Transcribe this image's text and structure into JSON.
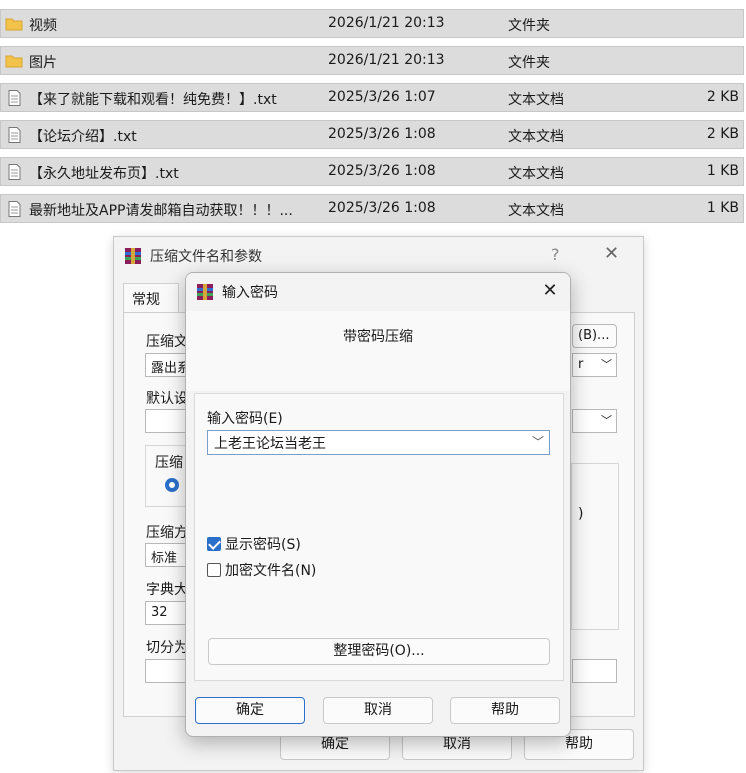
{
  "file_list": [
    {
      "name": "视频",
      "date": "2026/1/21 20:13",
      "type": "文件夹",
      "size": "",
      "icon": "folder-icon"
    },
    {
      "name": "图片",
      "date": "2026/1/21 20:13",
      "type": "文件夹",
      "size": "",
      "icon": "folder-icon"
    },
    {
      "name": "【来了就能下载和观看！纯免费！】.txt",
      "date": "2025/3/26 1:07",
      "type": "文本文档",
      "size": "2 KB",
      "icon": "text-file-icon"
    },
    {
      "name": "【论坛介绍】.txt",
      "date": "2025/3/26 1:08",
      "type": "文本文档",
      "size": "2 KB",
      "icon": "text-file-icon"
    },
    {
      "name": "【永久地址发布页】.txt",
      "date": "2025/3/26 1:08",
      "type": "文本文档",
      "size": "1 KB",
      "icon": "text-file-icon"
    },
    {
      "name": "最新地址及APP请发邮箱自动获取！！！...",
      "date": "2025/3/26 1:08",
      "type": "文本文档",
      "size": "1 KB",
      "icon": "text-file-icon"
    }
  ],
  "bg_dialog": {
    "title": "压缩文件名和参数",
    "help": "?",
    "close": "✕",
    "tab_general": "常规",
    "label_archive": "压缩文",
    "archive_value": "露出系",
    "browse_tail": "(B)...",
    "format_tail": "r",
    "label_default": "默认设",
    "label_format_group": "压缩",
    "label_method": "压缩方",
    "method_value": "标准",
    "label_dict": "字典大",
    "dict_value": "32",
    "label_split": "切分为",
    "paren_tail": ")",
    "ok": "确定",
    "cancel": "取消",
    "help_btn": "帮助"
  },
  "dialog": {
    "title": "输入密码",
    "close": "✕",
    "header": "带密码压缩",
    "password_label": "输入密码(E)",
    "password_value": "上老王论坛当老王",
    "show_password": "显示密码(S)",
    "show_password_checked": true,
    "encrypt_names": "加密文件名(N)",
    "encrypt_names_checked": false,
    "manage_button": "整理密码(O)...",
    "ok": "确定",
    "cancel": "取消",
    "help": "帮助"
  },
  "colors": {
    "accent": "#2a6fc9",
    "folder": "#f2c24b",
    "row_bg": "#dcdcdc"
  }
}
